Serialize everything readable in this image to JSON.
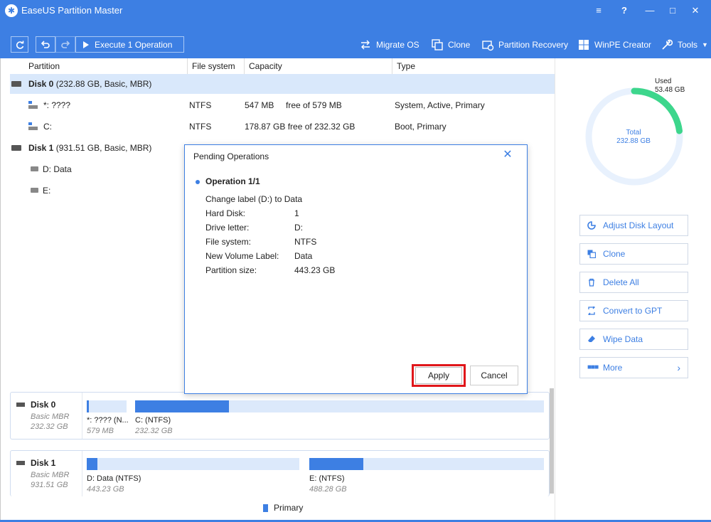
{
  "app": {
    "title": "EaseUS Partition Master"
  },
  "window_controls": {
    "menu": "≡",
    "help": "?",
    "minimize": "—",
    "maximize": "□",
    "close": "✕"
  },
  "toolbar": {
    "execute_label": "Execute 1 Operation",
    "tools": [
      {
        "label": "Migrate OS",
        "icon": "migrate-icon"
      },
      {
        "label": "Clone",
        "icon": "clone-icon"
      },
      {
        "label": "Partition Recovery",
        "icon": "recovery-icon"
      },
      {
        "label": "WinPE Creator",
        "icon": "windows-icon"
      },
      {
        "label": "Tools",
        "icon": "wrench-icon",
        "dropdown": true
      }
    ]
  },
  "table": {
    "columns": [
      "Partition",
      "File system",
      "Capacity",
      "Type"
    ],
    "rows": [
      {
        "kind": "disk",
        "label": "Disk 0",
        "detail": "(232.88 GB, Basic, MBR)",
        "selected": true
      },
      {
        "kind": "partition",
        "name": "*: ????",
        "fs": "NTFS",
        "capacity_used": "547 MB",
        "capacity_free": "free of 579 MB",
        "type": "System, Active, Primary"
      },
      {
        "kind": "partition",
        "name": "C:",
        "fs": "NTFS",
        "capacity_used": "178.87 GB free of 232.32 GB",
        "capacity_free": "",
        "type": "Boot, Primary"
      },
      {
        "kind": "disk",
        "label": "Disk 1",
        "detail": "(931.51 GB, Basic, MBR)"
      },
      {
        "kind": "partition",
        "name": "D: Data"
      },
      {
        "kind": "partition",
        "name": "E:"
      }
    ]
  },
  "dialog": {
    "title": "Pending Operations",
    "operation_heading": "Operation 1/1",
    "description": "Change label (D:)  to Data",
    "details": [
      {
        "key": "Hard Disk:",
        "value": "1"
      },
      {
        "key": "Drive letter:",
        "value": "D:"
      },
      {
        "key": "File system:",
        "value": "NTFS"
      },
      {
        "key": "New Volume Label:",
        "value": "Data"
      },
      {
        "key": "Partition size:",
        "value": "443.23 GB"
      }
    ],
    "apply_label": "Apply",
    "cancel_label": "Cancel"
  },
  "usage": {
    "used_label": "Used",
    "used_value": "53.48 GB",
    "total_label": "Total",
    "total_value": "232.88 GB",
    "used_fraction": 0.23,
    "ring_track_color": "#e8f1fd",
    "ring_used_color": "#3dd68c"
  },
  "actions": [
    {
      "label": "Adjust Disk Layout",
      "icon": "adjust-icon"
    },
    {
      "label": "Clone",
      "icon": "clone-icon"
    },
    {
      "label": "Delete All",
      "icon": "trash-icon"
    },
    {
      "label": "Convert to GPT",
      "icon": "convert-icon"
    },
    {
      "label": "Wipe Data",
      "icon": "wipe-icon"
    },
    {
      "label": "More",
      "icon": "more-icon",
      "chevron": "›"
    }
  ],
  "disk_map": [
    {
      "name": "Disk 0",
      "type": "Basic MBR",
      "size": "232.32 GB",
      "partitions": [
        {
          "label": "*: ???? (N...",
          "size": "579 MB",
          "used_fraction": 0.05
        },
        {
          "label": "C:  (NTFS)",
          "size": "232.32 GB",
          "used_fraction": 0.23
        }
      ]
    },
    {
      "name": "Disk 1",
      "type": "Basic MBR",
      "size": "931.51 GB",
      "partitions": [
        {
          "label": "D: Data (NTFS)",
          "size": "443.23 GB",
          "used_fraction": 0.05
        },
        {
          "label": "E:  (NTFS)",
          "size": "488.28 GB",
          "used_fraction": 0.23
        }
      ]
    }
  ],
  "legend": {
    "label": "Primary",
    "color": "#3d7fe3"
  }
}
